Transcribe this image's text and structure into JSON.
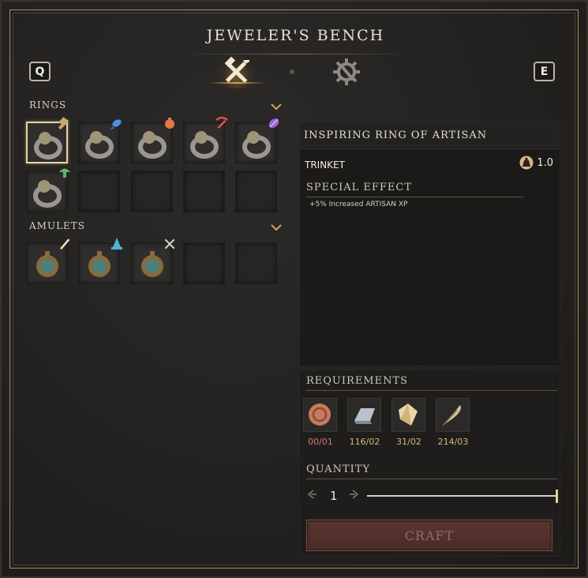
{
  "title": "JEWELER'S BENCH",
  "keys": {
    "prev": "Q",
    "next": "E"
  },
  "tabs": [
    {
      "icon": "hammer-pickaxe-icon",
      "active": true
    },
    {
      "icon": "gear-wrench-icon",
      "active": false
    }
  ],
  "sections": {
    "rings": {
      "label": "RINGS",
      "items": [
        {
          "type": "ring",
          "perk": "hammer-icon",
          "selected": true
        },
        {
          "type": "ring",
          "perk": "fish-icon"
        },
        {
          "type": "ring",
          "perk": "bag-icon"
        },
        {
          "type": "ring",
          "perk": "pickaxe-icon"
        },
        {
          "type": "ring",
          "perk": "leaf-icon"
        },
        {
          "type": "ring",
          "perk": "mushroom-icon"
        }
      ]
    },
    "amulets": {
      "label": "AMULETS",
      "items": [
        {
          "type": "amulet",
          "perk": "sword-icon"
        },
        {
          "type": "amulet",
          "perk": "mage-hat-icon"
        },
        {
          "type": "amulet",
          "perk": "crossed-swords-icon"
        }
      ]
    }
  },
  "detail": {
    "name": "INSPIRING RING OF ARTISAN",
    "item_type": "TRINKET",
    "weight": "1.0",
    "special_label": "SPECIAL EFFECT",
    "effect": "+5% Increased ARTISAN XP"
  },
  "requirements": {
    "label": "REQUIREMENTS",
    "materials": [
      {
        "icon": "setting-icon",
        "count": "00/01",
        "short": true
      },
      {
        "icon": "ingot-icon",
        "count": "116/02",
        "short": false
      },
      {
        "icon": "gem-icon",
        "count": "31/02",
        "short": false
      },
      {
        "icon": "feather-icon",
        "count": "214/03",
        "short": false
      }
    ]
  },
  "quantity": {
    "label": "QUANTITY",
    "value": "1"
  },
  "craft_label": "CRAFT",
  "colors": {
    "accent": "#d2a35b",
    "shortage": "#e0736b",
    "count": "#d7b77a",
    "craft_bg": "#4a2b27"
  }
}
